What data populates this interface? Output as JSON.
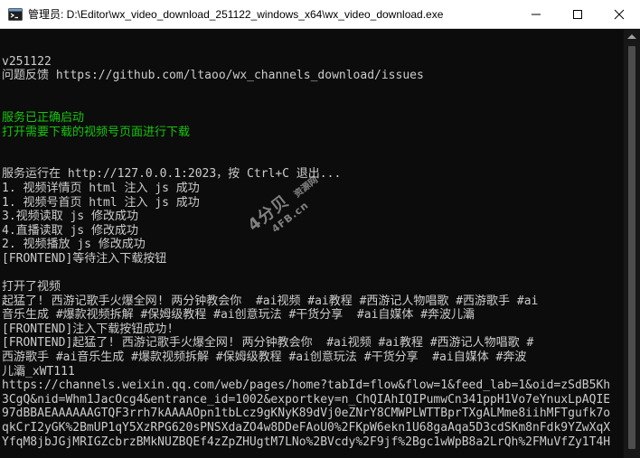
{
  "window": {
    "title": "管理员: D:\\Editor\\wx_video_download_251122_windows_x64\\wx_video_download.exe",
    "app_icon": "console-icon",
    "buttons": [
      "minimize-icon",
      "maximize-icon",
      "close-icon"
    ]
  },
  "console": {
    "text_color": "#cccccc",
    "success_color": "#16c60c",
    "background": "#0c0c0c",
    "lines": [
      {
        "text": "",
        "style": "normal"
      },
      {
        "text": "v251122",
        "style": "normal"
      },
      {
        "text": "问题反馈 https://github.com/ltaoo/wx_channels_download/issues",
        "style": "normal"
      },
      {
        "text": "",
        "style": "normal"
      },
      {
        "text": "",
        "style": "normal"
      },
      {
        "text": "服务已正确启动",
        "style": "green"
      },
      {
        "text": "打开需要下载的视频号页面进行下载",
        "style": "green"
      },
      {
        "text": "",
        "style": "normal"
      },
      {
        "text": "",
        "style": "normal"
      },
      {
        "text": "服务运行在 http://127.0.0.1:2023，按 Ctrl+C 退出...",
        "style": "normal"
      },
      {
        "text": "1. 视频详情页 html 注入 js 成功",
        "style": "normal"
      },
      {
        "text": "1. 视频号首页 html 注入 js 成功",
        "style": "normal"
      },
      {
        "text": "3.视频读取 js 修改成功",
        "style": "normal"
      },
      {
        "text": "4.直播读取 js 修改成功",
        "style": "normal"
      },
      {
        "text": "2. 视频播放 js 修改成功",
        "style": "normal"
      },
      {
        "text": "[FRONTEND]等待注入下载按钮",
        "style": "normal"
      },
      {
        "text": "",
        "style": "normal"
      },
      {
        "text": "打开了视频",
        "style": "normal"
      },
      {
        "text": "起猛了! 西游记歌手火爆全网! 两分钟教会你  #ai视频 #ai教程 #西游记人物唱歌 #西游歌手 #ai",
        "style": "normal"
      },
      {
        "text": "音乐生成 #爆款视频拆解 #保姆级教程 #ai创意玩法 #干货分享  #ai自媒体 #奔波儿灞",
        "style": "normal"
      },
      {
        "text": "[FRONTEND]注入下载按钮成功!",
        "style": "normal"
      },
      {
        "text": "[FRONTEND]起猛了! 西游记歌手火爆全网! 两分钟教会你  #ai视频 #ai教程 #西游记人物唱歌 #",
        "style": "normal"
      },
      {
        "text": "西游歌手 #ai音乐生成 #爆款视频拆解 #保姆级教程 #ai创意玩法 #干货分享  #ai自媒体 #奔波",
        "style": "normal"
      },
      {
        "text": "儿灞_xWT111",
        "style": "normal"
      },
      {
        "text": "https://channels.weixin.qq.com/web/pages/home?tabId=flow&flow=1&feed_lab=1&oid=zSdB5Kh",
        "style": "normal"
      },
      {
        "text": "3CgQ&nid=Whm1JacOcg4&entrance_id=1002&exportkey=n_ChQIAhIQIPumwCn341ppH1Vo7eYnuxLpAQIE",
        "style": "normal"
      },
      {
        "text": "97dBBAEAAAAAAGTQF3rrh7kAAAAOpn1tbLcz9gKNyK89dVj0eZNrY8CMWPLWTTBprTXgALMme8iihMFTgufk7o",
        "style": "normal"
      },
      {
        "text": "qkCrI2yGK%2BmUP1qY5XzRPG620sPNSXdaZO4w8DDeFAoU0%2FKpW6ekn1U68gaAqa5D3cdSKm8nFdk9YZwXqX",
        "style": "normal"
      },
      {
        "text": "YfqM8jbJGjMRIGZcbrzBMkNUZBQEf4zZpZHUgtM7LNo%2BVcdy%2F9jf%2Bgc1wWpB8a2LrQh%2FMuVfZy1T4H",
        "style": "normal"
      }
    ]
  },
  "watermark": {
    "main": "4分贝",
    "tag": "资源网",
    "sub": "4FB.cn"
  }
}
